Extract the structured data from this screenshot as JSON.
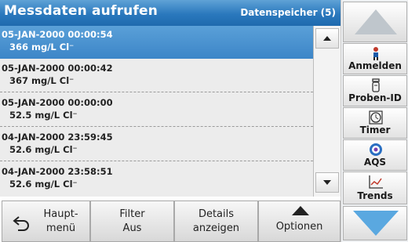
{
  "header": {
    "title": "Messdaten aufrufen",
    "memory_label": "Datenspeicher (5)"
  },
  "records": [
    {
      "datetime": "05-JAN-2000  00:00:54",
      "value": "366  mg/L  Cl⁻",
      "selected": true
    },
    {
      "datetime": "05-JAN-2000  00:00:42",
      "value": "367  mg/L  Cl⁻",
      "selected": false
    },
    {
      "datetime": "05-JAN-2000  00:00:00",
      "value": "52.5  mg/L  Cl⁻",
      "selected": false
    },
    {
      "datetime": "04-JAN-2000  23:59:45",
      "value": "52.6  mg/L  Cl⁻",
      "selected": false
    },
    {
      "datetime": "04-JAN-2000  23:58:51",
      "value": "52.6  mg/L  Cl⁻",
      "selected": false
    }
  ],
  "bottom": {
    "main_menu": [
      "Haupt-",
      "menü"
    ],
    "filter": [
      "Filter",
      "Aus"
    ],
    "details": [
      "Details",
      "anzeigen"
    ],
    "options": "Optionen"
  },
  "sidebar": {
    "items": [
      {
        "label": "Anmelden",
        "icon": "user-icon"
      },
      {
        "label": "Proben-ID",
        "icon": "sample-vial-icon"
      },
      {
        "label": "Timer",
        "icon": "timer-icon"
      },
      {
        "label": "AQS",
        "icon": "aqs-icon"
      },
      {
        "label": "Trends",
        "icon": "trends-chart-icon"
      }
    ]
  },
  "colors": {
    "accent": "#2a78bd",
    "nav_arrow": "#5aa8e0"
  }
}
